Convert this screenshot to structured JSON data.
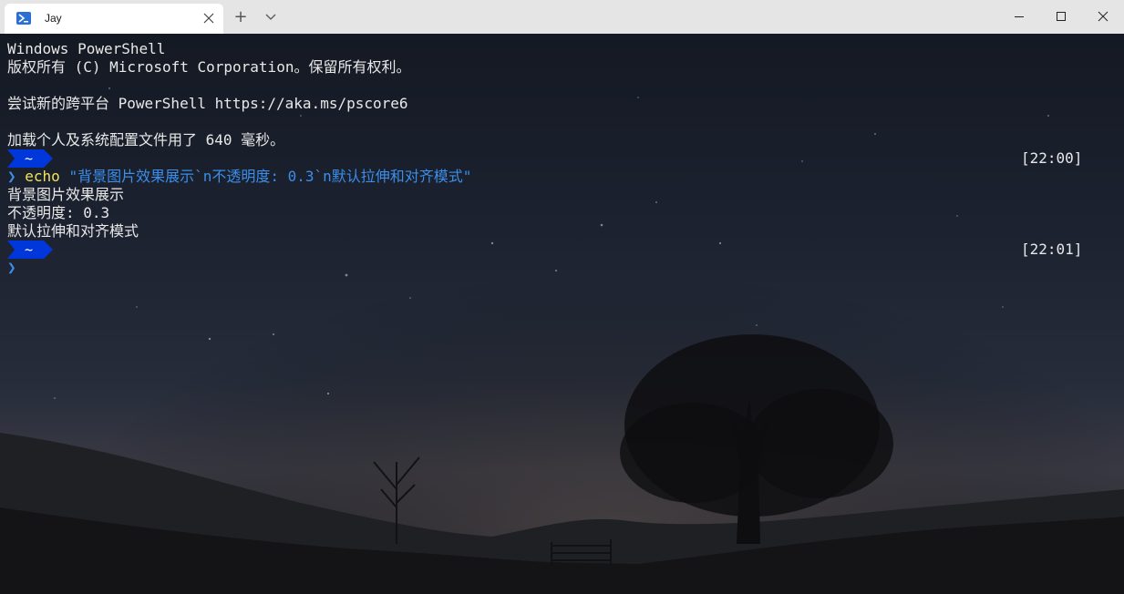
{
  "titlebar": {
    "tab_title": "Jay",
    "tab_icon": "powershell-icon",
    "close_icon": "close-icon",
    "new_tab_icon": "plus-icon",
    "new_tab_symbol": "+",
    "dropdown_icon": "chevron-down-icon",
    "window_controls": [
      "minimize-icon",
      "maximize-icon",
      "close-icon"
    ]
  },
  "terminal": {
    "header_lines": [
      "Windows PowerShell",
      "版权所有 (C) Microsoft Corporation。保留所有权利。",
      "",
      "尝试新的跨平台 PowerShell https://aka.ms/pscore6",
      "",
      "加载个人及系统配置文件用了 640 毫秒。"
    ],
    "prompts": [
      {
        "path": "~",
        "time": "[22:00]",
        "chevron": "❯",
        "command": "echo",
        "argument": "\"背景图片效果展示`n不透明度: 0.3`n默认拉伸和对齐模式\"",
        "output": [
          "背景图片效果展示",
          "不透明度: 0.3",
          "默认拉伸和对齐模式"
        ]
      },
      {
        "path": "~",
        "time": "[22:01]",
        "chevron": "❯"
      }
    ]
  },
  "colors": {
    "prompt_badge": "#0037da",
    "chevron": "#3b8eea",
    "command": "#f2e35c",
    "string": "#3b8eea",
    "text": "#e8e8e8",
    "titlebar": "#e5e5e5"
  }
}
